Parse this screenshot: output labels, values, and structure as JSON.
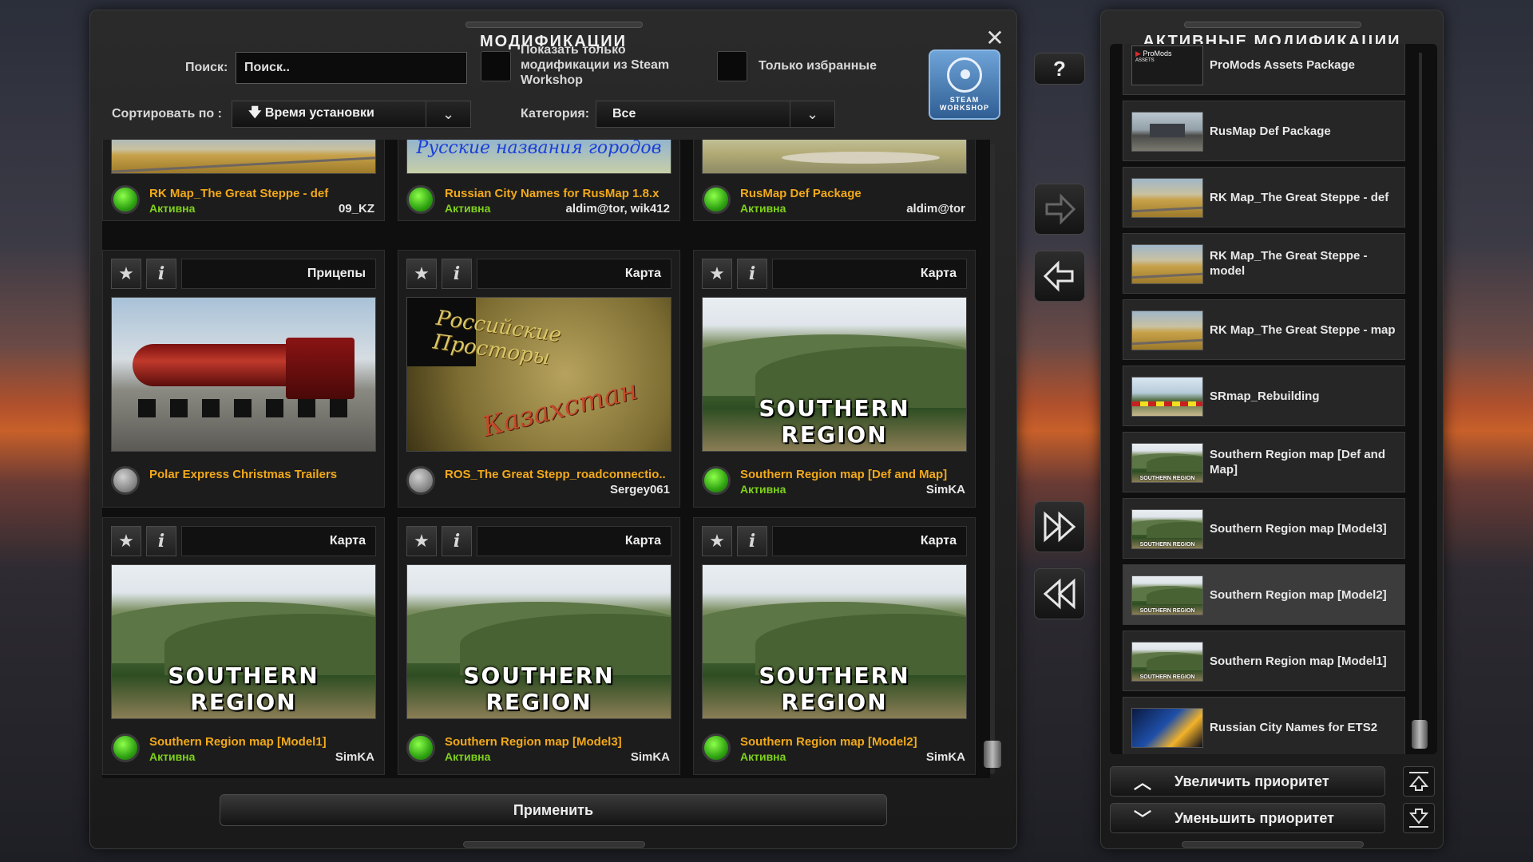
{
  "mods_panel": {
    "title": "МОДИФИКАЦИИ",
    "close_icon": "close-icon",
    "search": {
      "label": "Поиск:",
      "value": "Поиск.."
    },
    "steam_only": {
      "label": "Показать только модификации из Steam Workshop",
      "checked": false
    },
    "favorites_only": {
      "label": "Только избранные",
      "checked": false
    },
    "steam_workshop_button": {
      "label_top": "STEAM",
      "label_bottom": "WORKSHOP"
    },
    "sort": {
      "label": "Сортировать по :",
      "value": "Время установки",
      "icon": "sort-down-icon"
    },
    "category": {
      "label": "Категория:",
      "value": "Все"
    },
    "apply_button": "Применить",
    "scroll_position": 0.97
  },
  "mods_grid": [
    {
      "name": "RK Map_The Great Steppe - def",
      "status": "Активна",
      "author": "09_KZ",
      "active": true,
      "category": "",
      "thumb": "steppe",
      "partial": true
    },
    {
      "name": "Russian City Names for RusMap 1.8.x",
      "status": "Активна",
      "author": "aldim@tor, wik412",
      "active": true,
      "category": "",
      "thumb": "rcn",
      "thumb_text": "Русские названия городов",
      "partial": true
    },
    {
      "name": "RusMap Def Package",
      "status": "Активна",
      "author": "aldim@tor",
      "active": true,
      "category": "",
      "thumb": "road",
      "partial": true
    },
    {
      "name": "Polar Express Christmas Trailers",
      "status": "",
      "author": "",
      "active": false,
      "category": "Прицепы",
      "thumb": "truck"
    },
    {
      "name": "ROS_The Great Stepp_roadconnectio..",
      "status": "",
      "author": "Sergey061",
      "active": false,
      "category": "Карта",
      "thumb": "ros",
      "thumb_text": "Российские Просторы",
      "thumb_text2": "Казахстан"
    },
    {
      "name": "Southern Region map [Def and Map]",
      "status": "Активна",
      "author": "SimKA",
      "active": true,
      "category": "Карта",
      "thumb": "mountain",
      "thumb_text": "SOUTHERN REGION"
    },
    {
      "name": "Southern Region map [Model1]",
      "status": "Активна",
      "author": "SimKA",
      "active": true,
      "category": "Карта",
      "thumb": "mountain",
      "thumb_text": "SOUTHERN REGION"
    },
    {
      "name": "Southern Region map [Model3]",
      "status": "Активна",
      "author": "SimKA",
      "active": true,
      "category": "Карта",
      "thumb": "mountain",
      "thumb_text": "SOUTHERN REGION"
    },
    {
      "name": "Southern Region map [Model2]",
      "status": "Активна",
      "author": "SimKA",
      "active": true,
      "category": "Карта",
      "thumb": "mountain",
      "thumb_text": "SOUTHERN REGION"
    }
  ],
  "middle_buttons": {
    "help": "?",
    "activate_icon": "arrow-right-icon",
    "deactivate_icon": "arrow-left-icon",
    "activate_all_icon": "double-arrow-right-icon",
    "deactivate_all_icon": "double-arrow-left-icon"
  },
  "active_panel": {
    "title": "АКТИВНЫЕ МОДИФИКАЦИИ",
    "items": [
      {
        "name": "ProMods Assets Package",
        "thumb": "promods",
        "thumb_text": "ProMods",
        "thumb_sub": "ASSETS"
      },
      {
        "name": "RusMap Def Package",
        "thumb": "rusmap"
      },
      {
        "name": "RK Map_The Great Steppe - def",
        "thumb": "steppe"
      },
      {
        "name": "RK Map_The Great Steppe - model",
        "thumb": "steppe"
      },
      {
        "name": "RK Map_The Great Steppe - map",
        "thumb": "steppe"
      },
      {
        "name": "SRmap_Rebuilding",
        "thumb": "srreb"
      },
      {
        "name": "Southern Region map [Def and Map]",
        "thumb": "mountain",
        "thumb_text": "SOUTHERN REGION"
      },
      {
        "name": "Southern Region map [Model3]",
        "thumb": "mountain",
        "thumb_text": "SOUTHERN REGION"
      },
      {
        "name": "Southern Region map [Model2]",
        "thumb": "mountain",
        "thumb_text": "SOUTHERN REGION",
        "highlighted": true
      },
      {
        "name": "Southern Region map [Model1]",
        "thumb": "mountain",
        "thumb_text": "SOUTHERN REGION"
      },
      {
        "name": "Russian City Names for ETS2",
        "thumb": "ets"
      }
    ],
    "increase_priority": "Увеличить приоритет",
    "decrease_priority": "Уменьшить приоритет",
    "scroll_position": 0.98
  },
  "colors": {
    "mod_name": "#f2a91a",
    "status_active": "#7fd21c",
    "steam_blue": "#2f5e93"
  }
}
